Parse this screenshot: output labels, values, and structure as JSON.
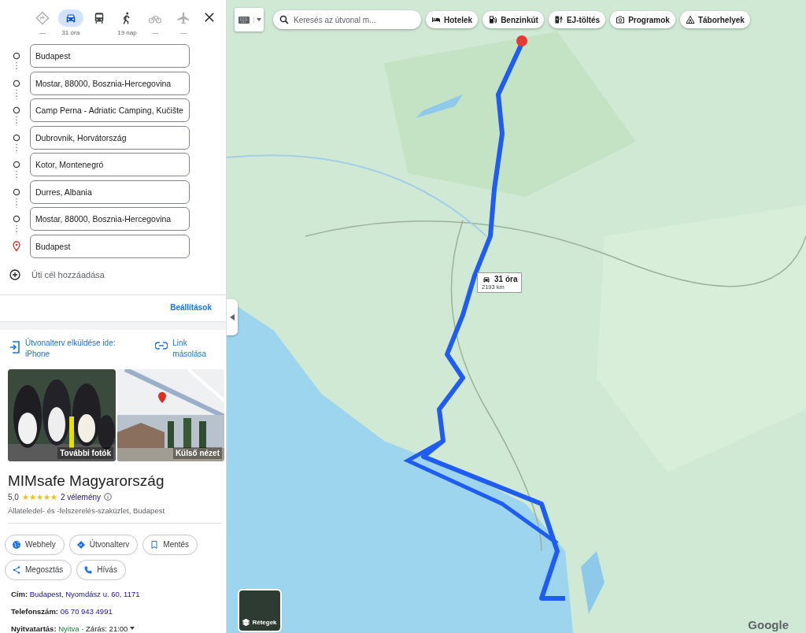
{
  "travel_modes": [
    {
      "kind": "best",
      "label": "—",
      "selected": false,
      "disabled": true
    },
    {
      "kind": "car",
      "label": "31 óra",
      "selected": true,
      "disabled": false
    },
    {
      "kind": "transit",
      "selected": false,
      "disabled": false
    },
    {
      "kind": "walk",
      "label": "19 nap",
      "selected": false,
      "disabled": false
    },
    {
      "kind": "bike",
      "label": "—",
      "selected": false,
      "disabled": true
    },
    {
      "kind": "plane",
      "label": "—",
      "selected": false,
      "disabled": true
    }
  ],
  "stops": [
    {
      "kind": "stop",
      "value": "Budapest"
    },
    {
      "kind": "stop",
      "value": "Mostar, 88000, Bosznia-Hercegovina"
    },
    {
      "kind": "stop",
      "value": "Camp Perna - Adriatic Camping, Kučište"
    },
    {
      "kind": "stop",
      "value": "Dubrovnik, Horvátország"
    },
    {
      "kind": "stop",
      "value": "Kotor, Montenegró"
    },
    {
      "kind": "stop",
      "value": "Durres, Albania"
    },
    {
      "kind": "stop",
      "value": "Mostar, 88000, Bosznia-Hercegovina"
    },
    {
      "kind": "destination",
      "value": "Budapest"
    }
  ],
  "add_destination": {
    "placeholder": "Úti cél hozzáadása"
  },
  "settings_link": "Beállítások",
  "share": {
    "send_link": "Útvonalterv elküldése ide: iPhone",
    "copy_link": "Link másolása"
  },
  "place": {
    "photos": [
      {
        "kind": "picture",
        "caption": "További fotók"
      },
      {
        "kind": "picture",
        "caption": "Külső nézet"
      }
    ],
    "name": "MIMsafe Magyarország",
    "rating": "5,0",
    "stars": 5,
    "reviews": "2 vélemény",
    "category": "Állateledel- és -felszerelés-szaküzlet, Budapest",
    "actions": [
      {
        "kind": "web",
        "label": "Webhely"
      },
      {
        "kind": "route",
        "label": "Útvonalterv"
      },
      {
        "kind": "save",
        "label": "Mentés"
      },
      {
        "kind": "share",
        "label": "Megosztás"
      },
      {
        "kind": "call",
        "label": "Hívás"
      }
    ],
    "address": {
      "label": "Cím:",
      "value": "Budapest, Nyomdász u. 60, 1171"
    },
    "phone": {
      "label": "Telefonszám:",
      "value": "06 70 943 4991"
    },
    "hours": {
      "label": "Nyitvatartás:",
      "status": "Nyitva",
      "closing": "· Zárás: 21:00"
    }
  },
  "map": {
    "search": {
      "placeholder": "Keresés az útvonal m..."
    },
    "chips": [
      {
        "kind": "hotel",
        "label": "Hotelek"
      },
      {
        "kind": "fuel",
        "label": "Benzinkút"
      },
      {
        "kind": "ev",
        "label": "EJ-töltés"
      },
      {
        "kind": "camera",
        "label": "Programok"
      },
      {
        "kind": "tent",
        "label": "Táborhelyek"
      }
    ],
    "route_info": {
      "duration": "31 óra",
      "distance": "2193 km"
    },
    "layers": "Rétegek",
    "logo": "Google"
  }
}
